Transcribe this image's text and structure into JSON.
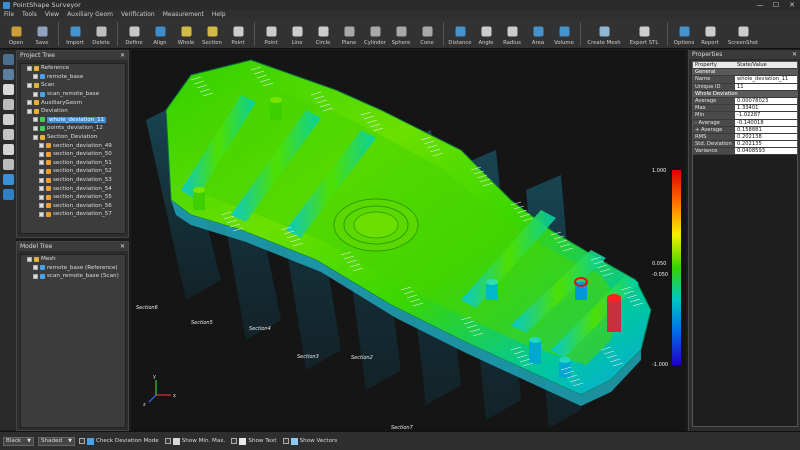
{
  "window": {
    "title": "PointShape Surveyor",
    "minimize": "—",
    "maximize": "☐",
    "close": "✕"
  },
  "menu": [
    "File",
    "Tools",
    "View",
    "Auxiliary Geom",
    "Verification",
    "Measurement",
    "Help"
  ],
  "toolbar": [
    {
      "label": "Open",
      "icon": "folder-open",
      "color": "#e7b23c"
    },
    {
      "label": "Save",
      "icon": "save",
      "color": "#9fb6d8"
    },
    {
      "sep": true
    },
    {
      "label": "Import",
      "icon": "import",
      "color": "#4aa3e8"
    },
    {
      "label": "Delete",
      "icon": "delete",
      "color": "#d8d8d8"
    },
    {
      "sep": true
    },
    {
      "label": "Define",
      "icon": "define",
      "color": "#e2e2e2"
    },
    {
      "label": "Align",
      "icon": "align",
      "color": "#3fa0e6"
    },
    {
      "label": "Whole",
      "icon": "whole",
      "color": "#f0d24a"
    },
    {
      "label": "Section",
      "icon": "section",
      "color": "#f0d24a"
    },
    {
      "label": "Point",
      "icon": "point",
      "color": "#e8e8e8"
    },
    {
      "sep": true
    },
    {
      "label": "Point",
      "icon": "dot",
      "color": "#e8e8e8"
    },
    {
      "label": "Line",
      "icon": "line",
      "color": "#e8e8e8"
    },
    {
      "label": "Circle",
      "icon": "circle",
      "color": "#e8e8e8"
    },
    {
      "label": "Plane",
      "icon": "plane",
      "color": "#bdbdbd"
    },
    {
      "label": "Cylinder",
      "icon": "cylinder",
      "color": "#bdbdbd"
    },
    {
      "label": "Sphere",
      "icon": "sphere",
      "color": "#bdbdbd"
    },
    {
      "label": "Cone",
      "icon": "cone",
      "color": "#bdbdbd"
    },
    {
      "sep": true
    },
    {
      "label": "Distance",
      "icon": "distance",
      "color": "#4aa3e8"
    },
    {
      "label": "Angle",
      "icon": "angle",
      "color": "#e8e8e8"
    },
    {
      "label": "Radius",
      "icon": "radius",
      "color": "#e8e8e8"
    },
    {
      "label": "Area",
      "icon": "area",
      "color": "#4aa3e8"
    },
    {
      "label": "Volume",
      "icon": "volume",
      "color": "#4aa3e8"
    },
    {
      "sep": true
    },
    {
      "label": "Create Mesh",
      "icon": "mesh",
      "color": "#9fd0f0",
      "wide": true
    },
    {
      "label": "Export STL",
      "icon": "export",
      "color": "#e8e8e8",
      "wide": true
    },
    {
      "sep": true
    },
    {
      "label": "Options",
      "icon": "options",
      "color": "#4aa3e8"
    },
    {
      "label": "Report",
      "icon": "report",
      "color": "#e8e8e8"
    },
    {
      "label": "ScreenShot",
      "icon": "screenshot",
      "color": "#e8e8e8",
      "wide": true
    }
  ],
  "project_tree": {
    "title": "Project Tree",
    "close": "✕",
    "rows": [
      {
        "label": "Reference",
        "indent": 1,
        "icon": "folder"
      },
      {
        "label": "remote_base",
        "indent": 2,
        "icon": "mesh"
      },
      {
        "label": "Scan",
        "indent": 1,
        "icon": "folder"
      },
      {
        "label": "scan_remote_base",
        "indent": 2,
        "icon": "mesh"
      },
      {
        "label": "AuxiliaryGeom",
        "indent": 1,
        "icon": "folder"
      },
      {
        "label": "Deviation",
        "indent": 1,
        "icon": "folder"
      },
      {
        "label": "whole_deviation_11",
        "indent": 2,
        "icon": "deviation",
        "selected": true
      },
      {
        "label": "points_deviation_12",
        "indent": 2,
        "icon": "deviation"
      },
      {
        "label": "Section_Deviation",
        "indent": 2,
        "icon": "folder"
      },
      {
        "label": "section_deviation_49",
        "indent": 3,
        "icon": "section"
      },
      {
        "label": "section_deviation_50",
        "indent": 3,
        "icon": "section"
      },
      {
        "label": "section_deviation_51",
        "indent": 3,
        "icon": "section"
      },
      {
        "label": "section_deviation_52",
        "indent": 3,
        "icon": "section"
      },
      {
        "label": "section_deviation_53",
        "indent": 3,
        "icon": "section"
      },
      {
        "label": "section_deviation_54",
        "indent": 3,
        "icon": "section"
      },
      {
        "label": "section_deviation_55",
        "indent": 3,
        "icon": "section"
      },
      {
        "label": "section_deviation_56",
        "indent": 3,
        "icon": "section"
      },
      {
        "label": "section_deviation_57",
        "indent": 3,
        "icon": "section"
      }
    ]
  },
  "model_tree": {
    "title": "Model Tree",
    "close": "✕",
    "rows": [
      {
        "label": "Mesh",
        "indent": 1,
        "icon": "folder"
      },
      {
        "label": "remote_base (Reference)",
        "indent": 2,
        "icon": "mesh"
      },
      {
        "label": "scan_remote_base (Scan)",
        "indent": 2,
        "icon": "mesh"
      }
    ]
  },
  "properties": {
    "title": "Properties",
    "close": "✕",
    "header": {
      "key": "Property",
      "value": "State/Value"
    },
    "rows": [
      {
        "group": "General"
      },
      {
        "key": "Name",
        "value": "whole_deviation_11"
      },
      {
        "key": "Unique ID",
        "value": "11"
      },
      {
        "group": "Whole Deviation"
      },
      {
        "key": "Average",
        "value": "0.00078023"
      },
      {
        "key": "Max",
        "value": "1.33401"
      },
      {
        "key": "Min",
        "value": "-1.02287"
      },
      {
        "key": "- Average",
        "value": "-0.140018"
      },
      {
        "key": "+ Average",
        "value": "0.158881"
      },
      {
        "key": "RMS",
        "value": "0.202138"
      },
      {
        "key": "Std. Deviation",
        "value": "0.202135"
      },
      {
        "key": "Variance",
        "value": "0.0408593"
      }
    ]
  },
  "legend": {
    "max": "1.000",
    "upper_tol": "0.050",
    "lower_tol": "-0.050",
    "min": "-1.000",
    "colors": [
      "#e00000",
      "#ff7a00",
      "#f8f000",
      "#37d400",
      "#00c8c0",
      "#0070e8",
      "#2000c8"
    ]
  },
  "sections": [
    "Section6",
    "Section5",
    "Section4",
    "Section3",
    "Section2",
    "Section7"
  ],
  "axis": {
    "x": "x",
    "y": "y",
    "z": "z"
  },
  "statusbar": {
    "display_mode": "Black",
    "render_mode": "Shaded",
    "check_deviation": "Check Deviation Mode",
    "show_min_max": "Show Min. Max.",
    "show_text": "Show Text",
    "show_vectors": "Show Vectors"
  }
}
